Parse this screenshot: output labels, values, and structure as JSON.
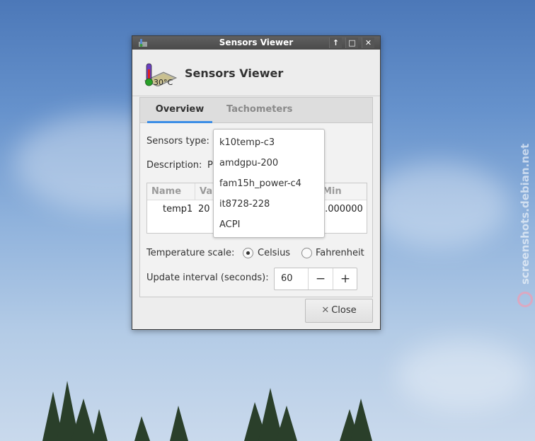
{
  "window": {
    "title": "Sensors Viewer",
    "header_title": "Sensors Viewer",
    "icon_text": "30°C",
    "buttons": {
      "shade": "↑",
      "maximize": "□",
      "close": "✕"
    }
  },
  "tabs": [
    {
      "label": "Overview",
      "active": true
    },
    {
      "label": "Tachometers",
      "active": false
    }
  ],
  "form": {
    "sensors_type_label": "Sensors type:",
    "description_label": "Description:",
    "description_value": "P",
    "temperature_scale_label": "Temperature scale:",
    "scale_options": [
      "Celsius",
      "Fahrenheit"
    ],
    "scale_selected": "Celsius",
    "update_interval_label": "Update interval (seconds):",
    "update_interval_value": "60",
    "minus": "−",
    "plus": "+"
  },
  "table": {
    "columns": [
      "Name",
      "Val",
      "Min"
    ],
    "row": {
      "name": "temp1",
      "value": "20 '",
      "min": ").000000"
    }
  },
  "dropdown": {
    "options": [
      "k10temp-c3",
      "amdgpu-200",
      "fam15h_power-c4",
      "it8728-228",
      "ACPI"
    ]
  },
  "close_button": {
    "icon": "✕",
    "label": "Close"
  },
  "watermark": "screenshots.debian.net",
  "colors": {
    "accent": "#3c8ee6",
    "titlebar": "#505050"
  }
}
